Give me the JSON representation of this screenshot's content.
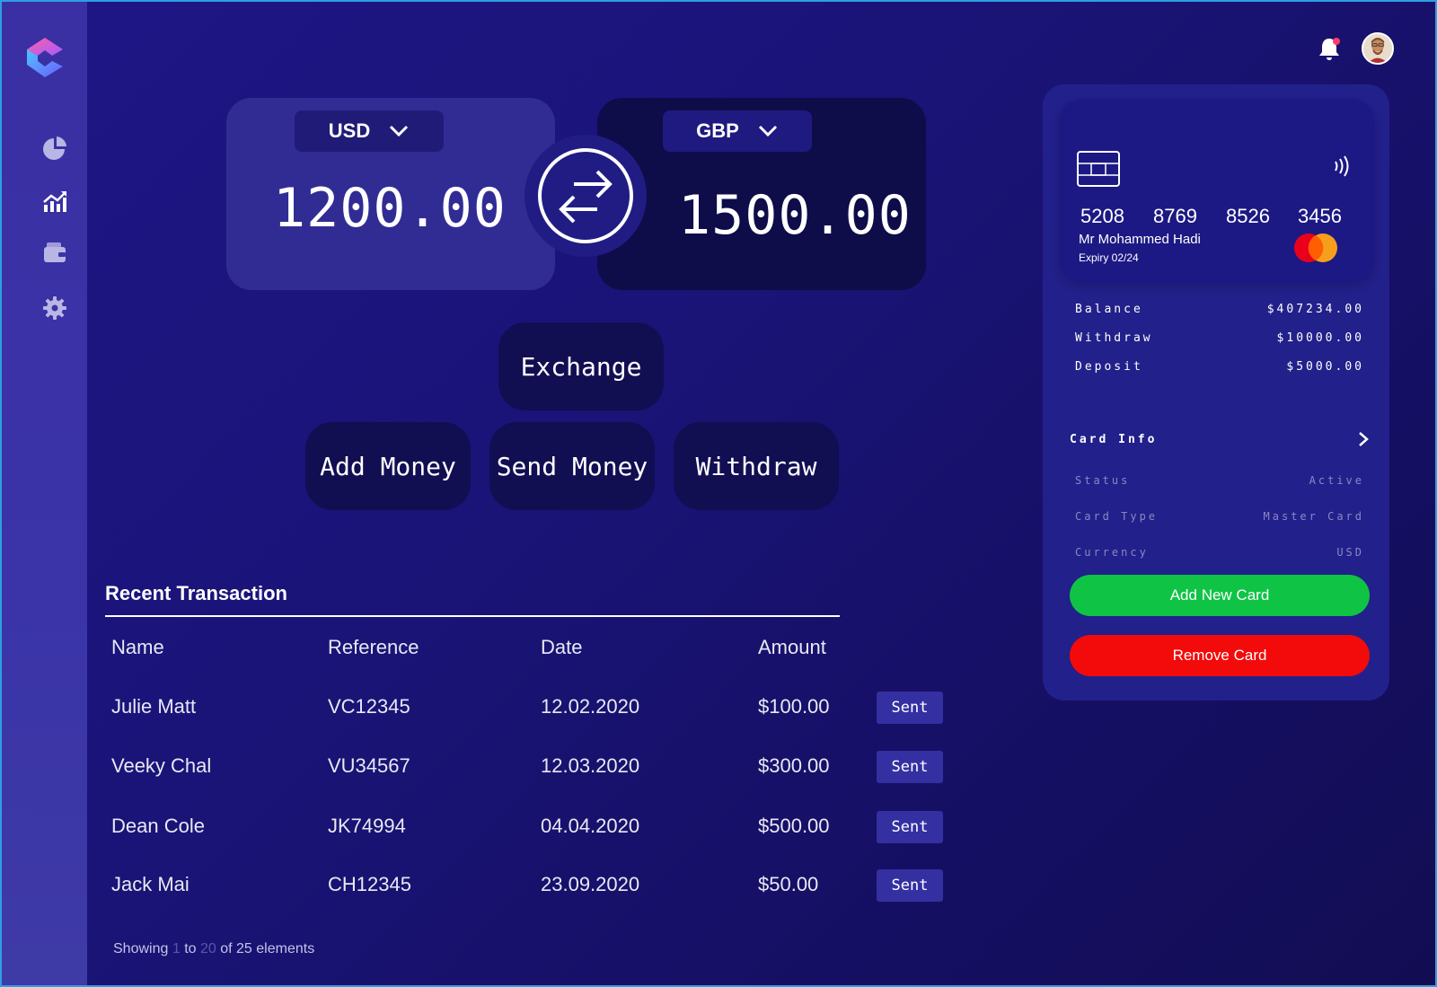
{
  "nav": {
    "icons": [
      "logo-icon",
      "pie-chart-icon",
      "analytics-icon",
      "wallet-icon",
      "settings-icon"
    ]
  },
  "header": {
    "icons": [
      "bell-icon",
      "avatar"
    ]
  },
  "exchange": {
    "from": {
      "currency": "USD",
      "amount": "1200.00"
    },
    "to": {
      "currency": "GBP",
      "amount": "1500.00"
    },
    "exchange_label": "Exchange"
  },
  "actions": {
    "add_money": "Add Money",
    "send_money": "Send Money",
    "withdraw": "Withdraw"
  },
  "transactions": {
    "title": "Recent Transaction",
    "columns": [
      "Name",
      "Reference",
      "Date",
      "Amount"
    ],
    "rows": [
      {
        "name": "Julie Matt",
        "reference": "VC12345",
        "date": "12.02.2020",
        "amount": "$100.00",
        "status": "Sent"
      },
      {
        "name": "Veeky Chal",
        "reference": "VU34567",
        "date": "12.03.2020",
        "amount": "$300.00",
        "status": "Sent"
      },
      {
        "name": "Dean Cole",
        "reference": "JK74994",
        "date": "04.04.2020",
        "amount": "$500.00",
        "status": "Sent"
      },
      {
        "name": "Jack Mai",
        "reference": "CH12345",
        "date": "23.09.2020",
        "amount": "$50.00",
        "status": "Sent"
      }
    ],
    "footer": {
      "showing": "Showing",
      "from": "1",
      "to_word": "to",
      "to": "20",
      "of_text": "of 25 elements"
    }
  },
  "card": {
    "number": [
      "5208",
      "8769",
      "8526",
      "3456"
    ],
    "holder": "Mr Mohammed Hadi",
    "expiry": "Expiry 02/24",
    "stats": [
      {
        "label": "Balance",
        "value": "$407234.00"
      },
      {
        "label": "Withdraw",
        "value": "$10000.00"
      },
      {
        "label": "Deposit",
        "value": "$5000.00"
      }
    ],
    "info_title": "Card Info",
    "info": [
      {
        "label": "Status",
        "value": "Active"
      },
      {
        "label": "Card Type",
        "value": "Master Card"
      },
      {
        "label": "Currency",
        "value": "USD"
      }
    ],
    "add_label": "Add New Card",
    "remove_label": "Remove Card"
  },
  "colors": {
    "background": "#1a1478",
    "sidebar": "#3a2fa3",
    "add_card": "#0fc445",
    "remove_card": "#f30a0a",
    "sent_badge": "#3430a2"
  }
}
